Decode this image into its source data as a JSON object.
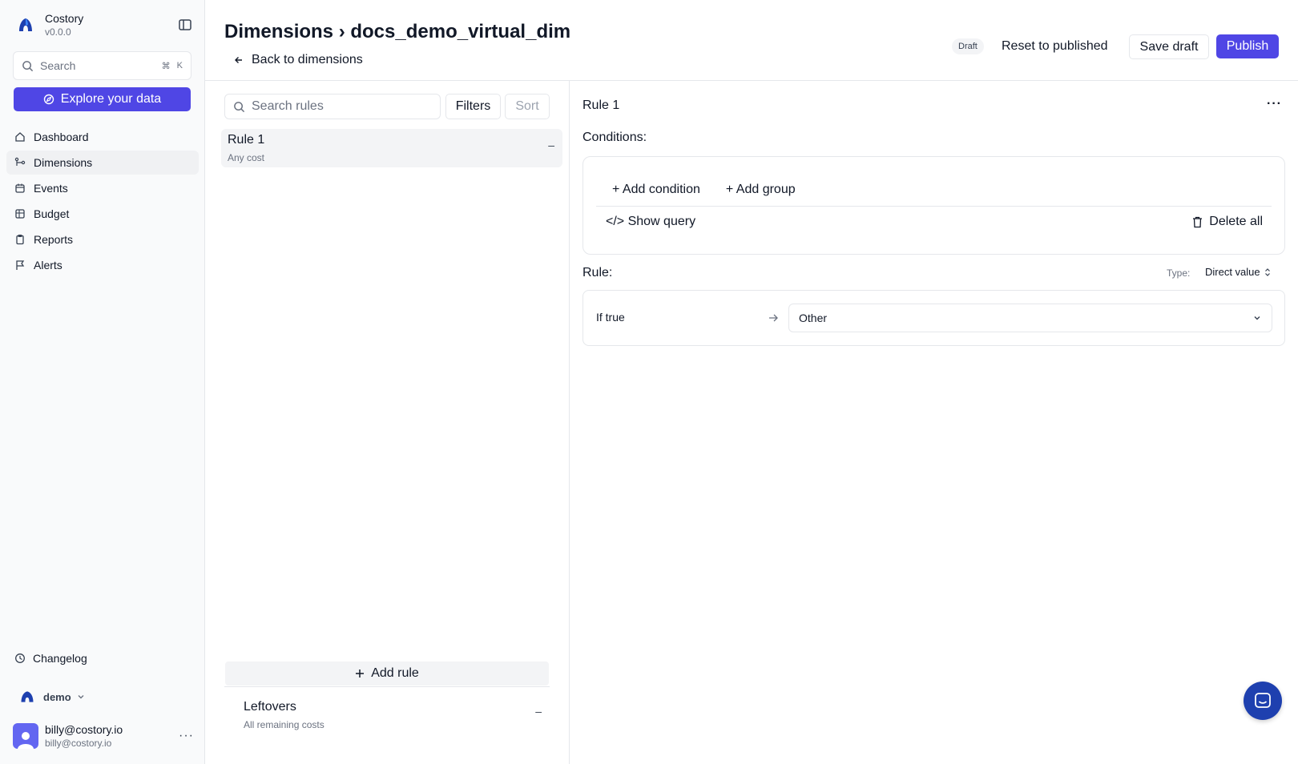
{
  "brand": {
    "name": "Costory",
    "version": "v0.0.0"
  },
  "sidebar": {
    "search_label": "Search",
    "search_kbd_cmd": "⌘",
    "search_kbd_key": "K",
    "explore_label": "Explore your data",
    "items": [
      {
        "label": "Dashboard",
        "icon": "home-icon",
        "active": false
      },
      {
        "label": "Dimensions",
        "icon": "dimensions-icon",
        "active": true
      },
      {
        "label": "Events",
        "icon": "calendar-icon",
        "active": false
      },
      {
        "label": "Budget",
        "icon": "table-icon",
        "active": false
      },
      {
        "label": "Reports",
        "icon": "clipboard-icon",
        "active": false
      },
      {
        "label": "Alerts",
        "icon": "flag-icon",
        "active": false
      }
    ],
    "changelog_label": "Changelog",
    "org_name": "demo",
    "user_name": "billy@costory.io",
    "user_email": "billy@costory.io",
    "user_menu_glyph": "···"
  },
  "header": {
    "title": "Dimensions › docs_demo_virtual_dim",
    "back_label": "Back to dimensions",
    "draft_badge": "Draft",
    "reset_label": "Reset to published",
    "save_label": "Save draft",
    "publish_label": "Publish"
  },
  "rules_panel": {
    "search_placeholder": "Search rules",
    "filters_label": "Filters",
    "sort_label": "Sort",
    "rules": [
      {
        "name": "Rule 1",
        "description": "Any cost",
        "collapse_glyph": "–"
      }
    ],
    "add_rule_label": "Add rule",
    "leftovers": {
      "name": "Leftovers",
      "description": "All remaining costs",
      "collapse_glyph": "–"
    }
  },
  "detail": {
    "title": "Rule 1",
    "more_glyph": "···",
    "conditions_label": "Conditions:",
    "add_condition_label": "+ Add condition",
    "add_group_label": "+ Add group",
    "show_query_label": "</> Show query",
    "delete_all_label": "Delete all",
    "rule_label": "Rule:",
    "type_label": "Type:",
    "type_value": "Direct value",
    "if_true_label": "If true",
    "value": "Other"
  },
  "colors": {
    "accent": "#4f46e5",
    "chat": "#1e40af",
    "border": "#e5e7eb"
  }
}
